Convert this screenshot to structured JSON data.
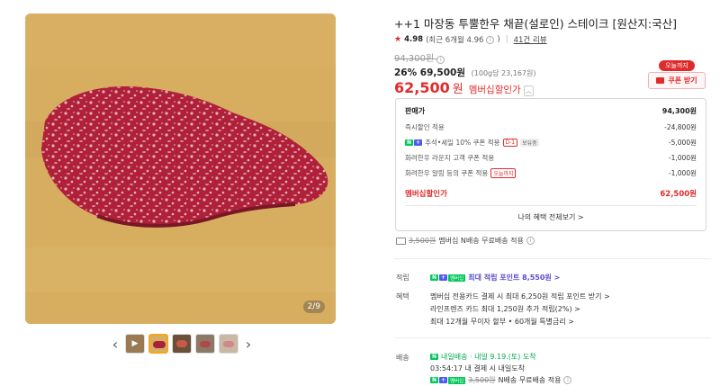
{
  "gallery": {
    "counter": "2/9",
    "prev_icon": "chevron-left-icon",
    "next_icon": "chevron-right-icon"
  },
  "product": {
    "title": "++1 마장동 투뿔한우 채끝(설로인) 스테이크 [원산지:국산]",
    "rating_score": "4.98",
    "rating_note": "(최근 6개월 4.96",
    "rating_note_end": ")",
    "review_count": "41건 리뷰",
    "original_price": "94,300원",
    "sale_percent": "26%",
    "sale_price": "69,500원",
    "unit_price": "(100g당 23,167원)",
    "member_price": "62,500",
    "member_won": "원",
    "member_label": "멤버십할인가"
  },
  "coupon": {
    "badge": "오늘까지",
    "button": "쿠폰 받기"
  },
  "breakdown": {
    "rows": [
      {
        "name": "판매가",
        "value": "94,300원"
      },
      {
        "name": "즉시할인 적용",
        "value": "-24,800원"
      },
      {
        "name": "추석•세일 10% 쿠폰 적용",
        "value": "-5,000원",
        "tag1": "D-1",
        "tag2": "보유중"
      },
      {
        "name": "화려한우 라운지 고객 쿠폰 적용",
        "value": "-1,000원"
      },
      {
        "name": "화려한우 알림 등의 쿠폰 적용",
        "value": "-1,000원",
        "tag1": "오늘까지"
      },
      {
        "name": "멤버십할인가",
        "value": "62,500원"
      }
    ],
    "benefits_link": "나의 혜택 전체보기 >"
  },
  "shipping": {
    "fee": "3,500원",
    "text": "멤버십 N배송 무료배송 적용"
  },
  "points": {
    "label": "적립",
    "text": "최대 적립 포인트 8,550원 >"
  },
  "perks": {
    "label": "혜택",
    "lines": [
      "멤버십 전용카드 결제 시 최대 6,250원 적립 포인트 받기 >",
      "라인프렌즈 카드 최대 1,250원 추가 적립(2%) >",
      "최대 12개월 무이자 할부 • 60개월 특별금리 >"
    ]
  },
  "delivery": {
    "label": "배송",
    "arrival": "내일배송 · 내일 9.19.(토) 도착",
    "deadline": "03:54:17 내 결제 시 내일도착",
    "fee": "3,500원",
    "fee_text": "N배송 무료배송 적용"
  },
  "npay_badge": {
    "n": "N",
    "plus": "+",
    "member": "멤버십"
  },
  "colors": {
    "accent": "#e02b2b",
    "naver_green": "#03c75a",
    "points_purple": "#5a4bd1"
  }
}
